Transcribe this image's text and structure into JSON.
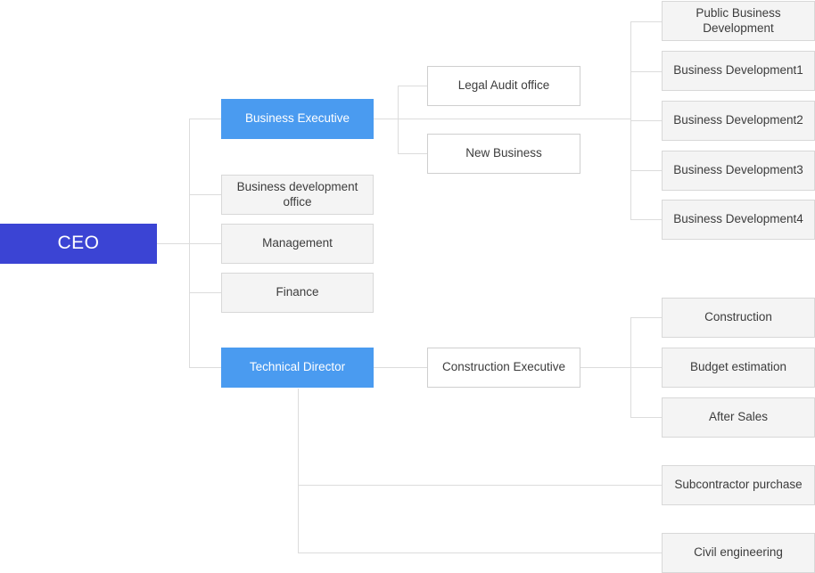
{
  "diagram": {
    "title": "Organization Chart",
    "type": "org-chart",
    "orientation": "left-to-right",
    "colors": {
      "root_fill": "#3b44d4",
      "root_text": "#ffffff",
      "executive_fill": "#4a9bf0",
      "executive_text": "#ffffff",
      "plain_fill": "#ffffff",
      "leaf_fill": "#f4f4f4",
      "node_border": "#d8d8d8",
      "connector": "#dcdcdc",
      "body_text": "#3c3c3c",
      "background": "#ffffff"
    }
  },
  "nodes": {
    "ceo": {
      "label": "CEO"
    },
    "business_executive": {
      "label": "Business Executive"
    },
    "business_development_office": {
      "label": "Business development office"
    },
    "management": {
      "label": "Management"
    },
    "finance": {
      "label": "Finance"
    },
    "technical_director": {
      "label": "Technical Director"
    },
    "legal_audit_office": {
      "label": "Legal Audit office"
    },
    "new_business": {
      "label": "New Business"
    },
    "construction_executive": {
      "label": "Construction Executive"
    },
    "public_business_development": {
      "label": "Public Business Development"
    },
    "business_development_1": {
      "label": "Business Development1"
    },
    "business_development_2": {
      "label": "Business Development2"
    },
    "business_development_3": {
      "label": "Business Development3"
    },
    "business_development_4": {
      "label": "Business Development4"
    },
    "construction": {
      "label": "Construction"
    },
    "budget_estimation": {
      "label": "Budget estimation"
    },
    "after_sales": {
      "label": "After Sales"
    },
    "subcontractor_purchase": {
      "label": "Subcontractor purchase"
    },
    "civil_engineering": {
      "label": "Civil engineering"
    }
  }
}
